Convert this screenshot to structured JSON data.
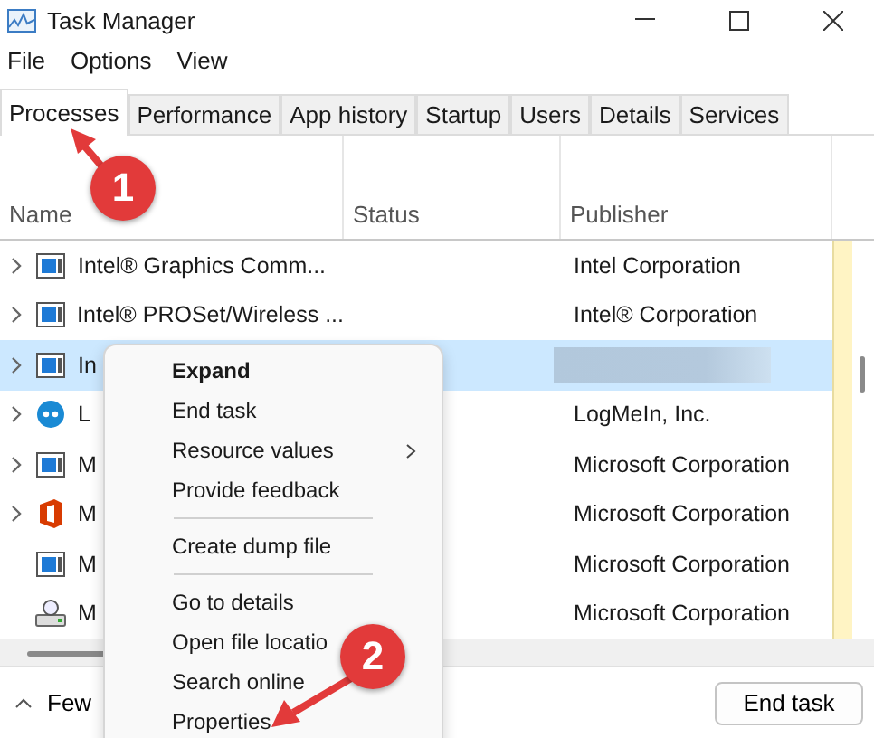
{
  "window": {
    "title": "Task Manager"
  },
  "menu": [
    "File",
    "Options",
    "View"
  ],
  "tabs": [
    {
      "label": "Processes",
      "selected": true
    },
    {
      "label": "Performance",
      "selected": false
    },
    {
      "label": "App history",
      "selected": false
    },
    {
      "label": "Startup",
      "selected": false
    },
    {
      "label": "Users",
      "selected": false
    },
    {
      "label": "Details",
      "selected": false
    },
    {
      "label": "Services",
      "selected": false
    }
  ],
  "columns": [
    "Name",
    "Status",
    "Publisher"
  ],
  "rows": [
    {
      "kind": "app",
      "name": "Intel® Graphics Comm...",
      "publisher": "Intel Corporation",
      "expandable": true,
      "selected": false,
      "redacted": false
    },
    {
      "kind": "app",
      "name": "Intel® PROSet/Wireless ...",
      "publisher": "Intel® Corporation",
      "expandable": true,
      "selected": false,
      "redacted": false
    },
    {
      "kind": "app",
      "name": "In",
      "expandable": true,
      "selected": true,
      "redacted": true
    },
    {
      "kind": "circle",
      "name": "L",
      "publisher": "LogMeIn, Inc.",
      "expandable": true,
      "selected": false,
      "redacted": false
    },
    {
      "kind": "app",
      "name": "M",
      "publisher": "Microsoft Corporation",
      "expandable": true,
      "selected": false,
      "redacted": false
    },
    {
      "kind": "office",
      "name": "M",
      "publisher": "Microsoft Corporation",
      "expandable": true,
      "selected": false,
      "redacted": false
    },
    {
      "kind": "app",
      "name": "M",
      "publisher": "Microsoft Corporation",
      "expandable": false,
      "selected": false,
      "redacted": false
    },
    {
      "kind": "scanner",
      "name": "M",
      "publisher": "Microsoft Corporation",
      "expandable": false,
      "selected": false,
      "redacted": false
    }
  ],
  "footer": {
    "details_toggle": "Few",
    "end_task": "End task"
  },
  "context_menu": [
    {
      "kind": "item",
      "label": "Expand",
      "bold": true,
      "submenu": false
    },
    {
      "kind": "item",
      "label": "End task",
      "bold": false,
      "submenu": false
    },
    {
      "kind": "item",
      "label": "Resource values",
      "bold": false,
      "submenu": true
    },
    {
      "kind": "item",
      "label": "Provide feedback",
      "bold": false,
      "submenu": false
    },
    {
      "kind": "separator"
    },
    {
      "kind": "item",
      "label": "Create dump file",
      "bold": false,
      "submenu": false
    },
    {
      "kind": "separator"
    },
    {
      "kind": "item",
      "label": "Go to details",
      "bold": false,
      "submenu": false
    },
    {
      "kind": "item",
      "label": "Open file locatio",
      "bold": false,
      "submenu": false
    },
    {
      "kind": "item",
      "label": "Search online",
      "bold": false,
      "submenu": false
    },
    {
      "kind": "item",
      "label": "Properties",
      "bold": false,
      "submenu": false
    }
  ],
  "annotations": [
    {
      "label": "1"
    },
    {
      "label": "2"
    }
  ]
}
